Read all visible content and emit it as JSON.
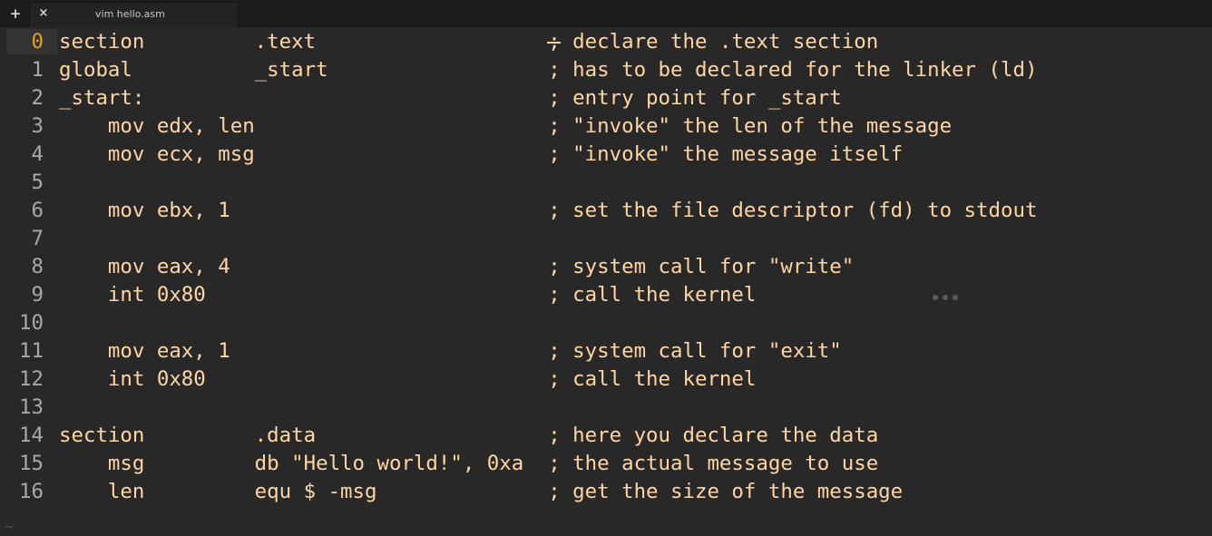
{
  "tab": {
    "add_label": "+",
    "close_label": "×",
    "title": "vim hello.asm"
  },
  "editor": {
    "current_line": 0,
    "lines": [
      {
        "num": "0",
        "text": "section         .text                   ; declare the .text section"
      },
      {
        "num": "1",
        "text": "global          _start                  ; has to be declared for the linker (ld)"
      },
      {
        "num": "2",
        "text": "_start:                                 ; entry point for _start"
      },
      {
        "num": "3",
        "text": "    mov edx, len                        ; \"invoke\" the len of the message"
      },
      {
        "num": "4",
        "text": "    mov ecx, msg                        ; \"invoke\" the message itself"
      },
      {
        "num": "5",
        "text": ""
      },
      {
        "num": "6",
        "text": "    mov ebx, 1                          ; set the file descriptor (fd) to stdout"
      },
      {
        "num": "7",
        "text": ""
      },
      {
        "num": "8",
        "text": "    mov eax, 4                          ; system call for \"write\""
      },
      {
        "num": "9",
        "text": "    int 0x80                            ; call the kernel"
      },
      {
        "num": "10",
        "text": ""
      },
      {
        "num": "11",
        "text": "    mov eax, 1                          ; system call for \"exit\""
      },
      {
        "num": "12",
        "text": "    int 0x80                            ; call the kernel"
      },
      {
        "num": "13",
        "text": ""
      },
      {
        "num": "14",
        "text": "section         .data                   ; here you declare the data"
      },
      {
        "num": "15",
        "text": "    msg         db \"Hello world!\", 0xa  ; the actual message to use"
      },
      {
        "num": "16",
        "text": "    len         equ $ -msg              ; get the size of the message"
      }
    ],
    "end_marker": "~"
  }
}
